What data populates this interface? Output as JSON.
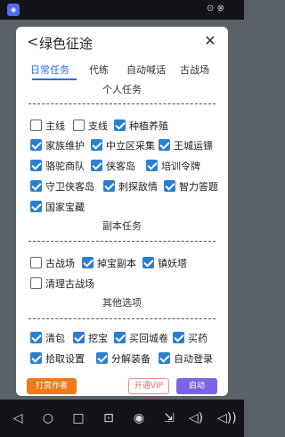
{
  "statusbar": {
    "app_icon_text": "◉",
    "time": "⊙ ⊗"
  },
  "dialog": {
    "title": "绿色征途",
    "back_glyph": "<",
    "close_glyph": "✕"
  },
  "tabs": [
    "日常任务",
    "代练",
    "自动喊话",
    "古战场"
  ],
  "sections": {
    "daily": "个人任务",
    "dungeon": "副本任务",
    "other": "其他选项"
  },
  "daily_items": [
    {
      "label": "主线",
      "checked": false
    },
    {
      "label": "支线",
      "checked": false
    },
    {
      "label": "种植养殖",
      "checked": true
    },
    {
      "label": "家族维护",
      "checked": true
    },
    {
      "label": "中立区采集",
      "checked": true
    },
    {
      "label": "王城运镖",
      "checked": true
    },
    {
      "label": "骆驼商队",
      "checked": true
    },
    {
      "label": "侠客岛",
      "checked": true
    },
    {
      "label": "培训令牌",
      "checked": true
    },
    {
      "label": "守卫侠客岛",
      "checked": true
    },
    {
      "label": "刺探敌情",
      "checked": true
    },
    {
      "label": "智力答题",
      "checked": true
    },
    {
      "label": "国家宝藏",
      "checked": true
    }
  ],
  "dungeon_items": [
    {
      "label": "古战场",
      "checked": false
    },
    {
      "label": "掉宝副本",
      "checked": true
    },
    {
      "label": "镇妖塔",
      "checked": true
    },
    {
      "label": "清理古战场",
      "checked": false
    }
  ],
  "other_items": [
    {
      "label": "清包",
      "checked": true
    },
    {
      "label": "挖宝",
      "checked": true
    },
    {
      "label": "买回城卷",
      "checked": true
    },
    {
      "label": "买药",
      "checked": true
    },
    {
      "label": "拾取设置",
      "checked": true
    },
    {
      "label": "分解装备",
      "checked": true
    },
    {
      "label": "自动登录",
      "checked": true
    }
  ],
  "buttons": {
    "tip": "打赏作者",
    "vip": "开通VIP",
    "start": "启动"
  },
  "divider_text": "",
  "navbar_icons": [
    "back-triangle-icon",
    "home-circle-icon",
    "recent-square-icon",
    "screenshot-icon",
    "eye-icon",
    "expand-icon",
    "volume-down-icon",
    "volume-up-icon"
  ],
  "navbar_glyphs": [
    "◁",
    "○",
    "□",
    "⊡",
    "◉",
    "⇲",
    "◁)",
    "◁))"
  ]
}
